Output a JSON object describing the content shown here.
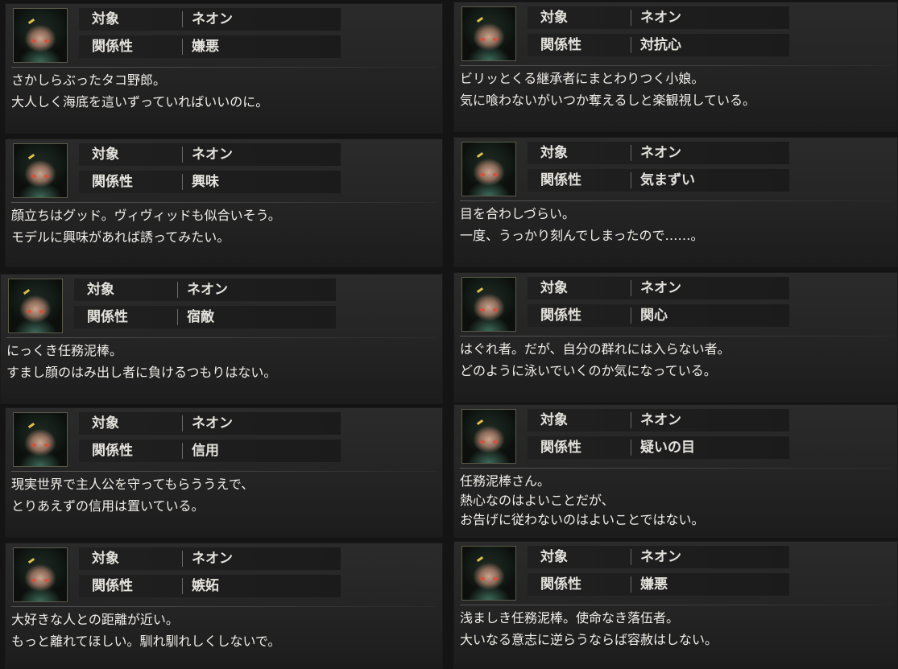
{
  "labels": {
    "target": "対象",
    "relation": "関係性"
  },
  "cards": [
    {
      "target": "ネオン",
      "relation": "嫌悪",
      "desc": "さかしらぶったタコ野郎。\n大人しく海底を這いずっていればいいのに。"
    },
    {
      "target": "ネオン",
      "relation": "対抗心",
      "desc": "ビリッとくる継承者にまとわりつく小娘。\n気に喰わないがいつか奪えるしと楽観視している。"
    },
    {
      "target": "ネオン",
      "relation": "興味",
      "desc": "顔立ちはグッド。ヴィヴィッドも似合いそう。\nモデルに興味があれば誘ってみたい。"
    },
    {
      "target": "ネオン",
      "relation": "気まずい",
      "desc": "目を合わしづらい。\n一度、うっかり刻んでしまったので……。"
    },
    {
      "target": "ネオン",
      "relation": "宿敵",
      "desc": "にっくき任務泥棒。\nすまし顔のはみ出し者に負けるつもりはない。"
    },
    {
      "target": "ネオン",
      "relation": "関心",
      "desc": "はぐれ者。だが、自分の群れには入らない者。\nどのように泳いでいくのか気になっている。"
    },
    {
      "target": "ネオン",
      "relation": "信用",
      "desc": "現実世界で主人公を守ってもらううえで、\nとりあえずの信用は置いている。"
    },
    {
      "target": "ネオン",
      "relation": "疑いの目",
      "desc": "任務泥棒さん。\n熱心なのはよいことだが、\nお告げに従わないのはよいことではない。"
    },
    {
      "target": "ネオン",
      "relation": "嫉妬",
      "desc": "大好きな人との距離が近い。\nもっと離れてほしい。馴れ馴れしくしないで。"
    },
    {
      "target": "ネオン",
      "relation": "嫌悪",
      "desc": "浅ましき任務泥棒。使命なき落伍者。\n大いなる意志に逆らうならば容赦はしない。"
    }
  ]
}
